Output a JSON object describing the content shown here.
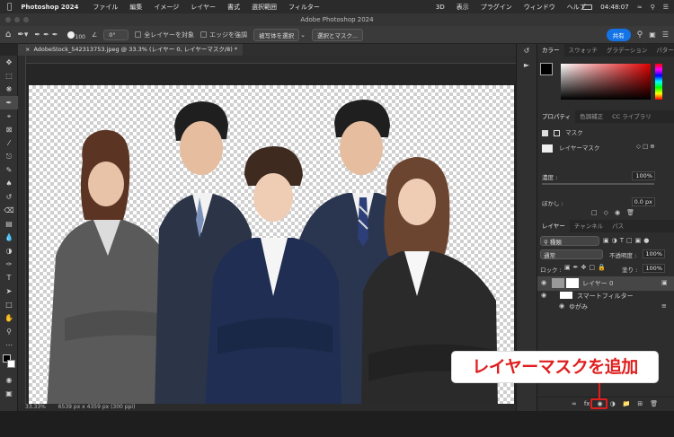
{
  "menubar": {
    "app_name": "Photoshop 2024",
    "items": [
      "ファイル",
      "編集",
      "イメージ",
      "レイヤー",
      "書式",
      "選択範囲",
      "フィルター",
      "3D",
      "表示",
      "プラグイン",
      "ウィンドウ",
      "ヘルプ"
    ],
    "clock": "04:48:07"
  },
  "window": {
    "title": "Adobe Photoshop 2024"
  },
  "options_bar": {
    "brush_size": "100",
    "angle": "0°",
    "sample_all_layers": "全レイヤーを対象",
    "enhance_edge": "エッジを強調",
    "select_subject": "被写体を選択",
    "select_and_mask": "選択とマスク...",
    "share": "共有"
  },
  "document": {
    "tab_title": "AdobeStock_542313753.jpeg @ 33.3% (レイヤー 0, レイヤーマスク/8) *",
    "zoom": "33.33%",
    "info": "6539 px x 4359 px (300 ppi)"
  },
  "color_panel": {
    "tabs": [
      "カラー",
      "スウォッチ",
      "グラデーション",
      "パターン"
    ]
  },
  "properties_panel": {
    "tabs": [
      "プロパティ",
      "色調補正",
      "CC ライブラリ"
    ],
    "mask_label": "マスク",
    "layer_mask_label": "レイヤーマスク",
    "density_label": "濃度 :",
    "density_value": "100%",
    "feather_label": "ぼかし :",
    "feather_value": "0.0 px"
  },
  "layers_panel": {
    "tabs": [
      "レイヤー",
      "チャンネル",
      "パス"
    ],
    "filter_kind": "種類",
    "blend_mode": "通常",
    "opacity_label": "不透明度 :",
    "opacity_value": "100%",
    "lock_label": "ロック :",
    "fill_label": "塗り :",
    "fill_value": "100%",
    "layers": [
      {
        "name": "レイヤー 0"
      },
      {
        "name": "スマートフィルター"
      },
      {
        "name": "ゆがみ"
      }
    ]
  },
  "annotation": {
    "callout_text": "レイヤーマスクを追加"
  },
  "colors": {
    "accent": "#1473e6",
    "callout": "#e01e1e"
  }
}
